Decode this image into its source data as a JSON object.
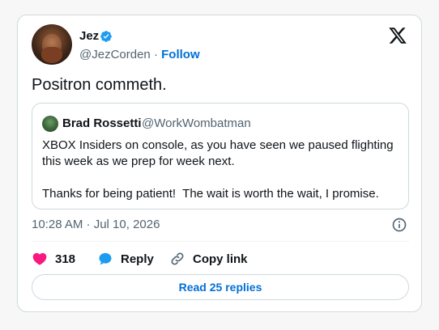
{
  "author": {
    "name": "Jez",
    "handle": "@JezCorden",
    "separator": "·",
    "follow_label": "Follow",
    "verified_color": "#1d9bf0"
  },
  "tweet": {
    "text": "Positron commeth.",
    "timestamp": "10:28 AM · Jul 10, 2026"
  },
  "quoted_tweet": {
    "name": "Brad Rossetti",
    "handle": "@WorkWombatman",
    "paragraph_1": "XBOX Insiders on console, as you have seen we paused flighting this week as we prep for week next.",
    "paragraph_2": "Thanks for being patient!  The wait is worth the wait, I promise."
  },
  "actions": {
    "like_count": "318",
    "reply_label": "Reply",
    "copy_label": "Copy link",
    "read_replies_label": "Read 25 replies"
  },
  "colors": {
    "like": "#f91880",
    "reply": "#1d9bf0",
    "link": "#006fd6",
    "secondary_text": "#536471"
  },
  "icons": {
    "brand": "x-logo-icon",
    "verified": "verified-badge-icon",
    "info": "info-icon",
    "like": "heart-icon",
    "reply": "speech-bubble-icon",
    "copy": "link-icon"
  }
}
